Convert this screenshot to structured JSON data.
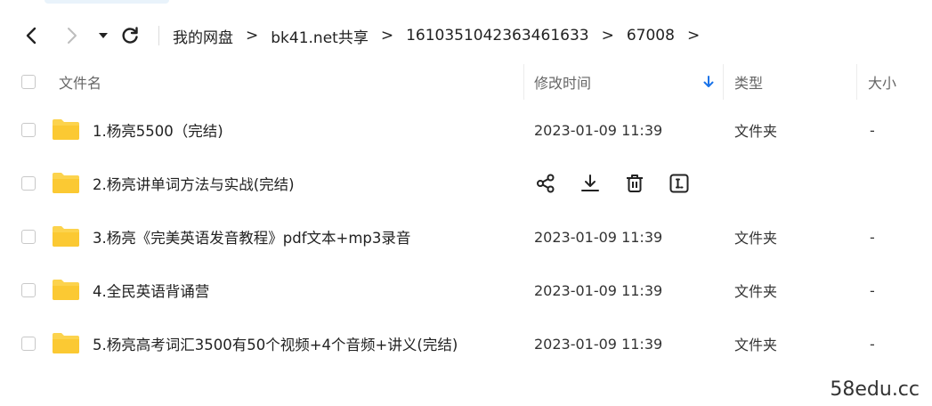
{
  "nav": {
    "back_icon": "chevron-left-icon",
    "forward_icon": "chevron-right-icon",
    "dropdown_icon": "caret-down-icon",
    "refresh_icon": "refresh-icon"
  },
  "breadcrumb": {
    "items": [
      "我的网盘",
      "bk41.net共享",
      "1610351042363461633",
      "67008"
    ],
    "separator": ">"
  },
  "table": {
    "columns": {
      "name": "文件名",
      "modified": "修改时间",
      "type": "类型",
      "size": "大小"
    },
    "sort_icon": "arrow-down-icon",
    "sort_color": "#1a73e8",
    "rows": [
      {
        "name": "1.杨亮5500（完结)",
        "modified": "2023-01-09 11:39",
        "type": "文件夹",
        "size": "-"
      },
      {
        "name": "2.杨亮讲单词方法与实战(完结)",
        "modified": "",
        "type": "",
        "size": "",
        "hovered": true
      },
      {
        "name": "3.杨亮《完美英语发音教程》pdf文本+mp3录音",
        "modified": "2023-01-09 11:39",
        "type": "文件夹",
        "size": "-"
      },
      {
        "name": "4.全民英语背诵营",
        "modified": "2023-01-09 11:39",
        "type": "文件夹",
        "size": "-"
      },
      {
        "name": "5.杨亮高考词汇3500有50个视频+4个音频+讲义(完结)",
        "modified": "2023-01-09 11:39",
        "type": "文件夹",
        "size": "-"
      }
    ],
    "hover_actions": [
      "share-icon",
      "download-icon",
      "delete-icon",
      "rename-icon"
    ]
  },
  "folder_color": "#fcd34d",
  "watermark": "58edu.cc"
}
